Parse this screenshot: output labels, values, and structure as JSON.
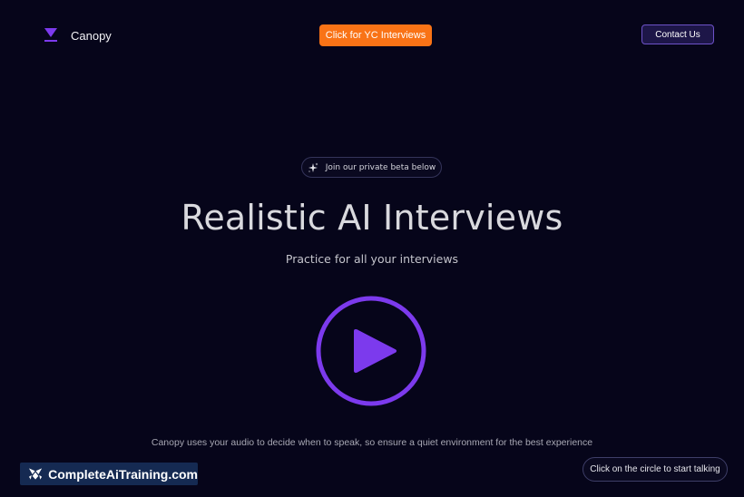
{
  "header": {
    "brand_name": "Canopy",
    "logo_icon": "canopy-logo-icon",
    "yc_button_label": "Click for YC Interviews",
    "contact_button_label": "Contact Us"
  },
  "hero": {
    "beta_pill_label": "Join our private beta below",
    "beta_pill_icon": "sparkle-icon",
    "title": "Realistic AI Interviews",
    "subtitle": "Practice for all your interviews",
    "play_icon": "play-icon"
  },
  "footer": {
    "audio_note": "Canopy uses your audio to decide when to speak, so ensure a quiet environment for the best experience",
    "talk_button_label": "Click on the circle to start talking"
  },
  "watermark": {
    "text": "CompleteAiTraining.com",
    "icon": "complete-ai-logo-icon"
  },
  "colors": {
    "background": "#06051a",
    "accent_purple": "#7c3aed",
    "accent_orange": "#f97316",
    "contact_bg": "#1d1648",
    "watermark_bg": "#152a52"
  }
}
